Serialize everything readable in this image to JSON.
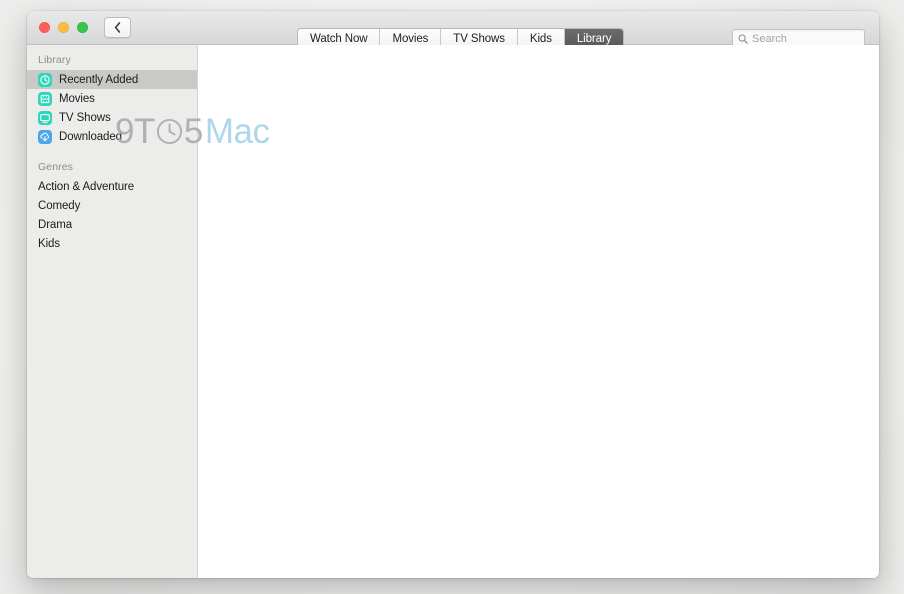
{
  "window": {
    "traffic_lights": [
      {
        "name": "close",
        "color": "#fc6058"
      },
      {
        "name": "minimize",
        "color": "#fdbc40"
      },
      {
        "name": "maximize",
        "color": "#34c749"
      }
    ],
    "back_button_label": "‹"
  },
  "toolbar": {
    "tabs": [
      {
        "label": "Watch Now",
        "selected": false
      },
      {
        "label": "Movies",
        "selected": false
      },
      {
        "label": "TV Shows",
        "selected": false
      },
      {
        "label": "Kids",
        "selected": false
      },
      {
        "label": "Library",
        "selected": true
      }
    ],
    "search": {
      "placeholder": "Search",
      "value": ""
    }
  },
  "sidebar": {
    "sections": [
      {
        "header": "Library",
        "items": [
          {
            "label": "Recently Added",
            "icon": "clock-icon",
            "icon_color": "#2fd5b8",
            "selected": true
          },
          {
            "label": "Movies",
            "icon": "film-icon",
            "icon_color": "#2fd5b8",
            "selected": false
          },
          {
            "label": "TV Shows",
            "icon": "tv-icon",
            "icon_color": "#2fd5b8",
            "selected": false
          },
          {
            "label": "Downloaded",
            "icon": "download-cloud-icon",
            "icon_color": "#4aa8e8",
            "selected": false
          }
        ]
      },
      {
        "header": "Genres",
        "items": [
          {
            "label": "Action & Adventure",
            "icon": null,
            "selected": false
          },
          {
            "label": "Comedy",
            "icon": null,
            "selected": false
          },
          {
            "label": "Drama",
            "icon": null,
            "selected": false
          },
          {
            "label": "Kids",
            "icon": null,
            "selected": false
          }
        ]
      }
    ],
    "selection_color": "#c9c9c7",
    "background_color": "#ececea"
  },
  "content": {
    "empty": true
  },
  "watermark": {
    "part_one": "9T",
    "part_two": "5",
    "part_three": "Mac",
    "dark_color": "#a9adb0",
    "light_color": "#a9d3ea"
  }
}
